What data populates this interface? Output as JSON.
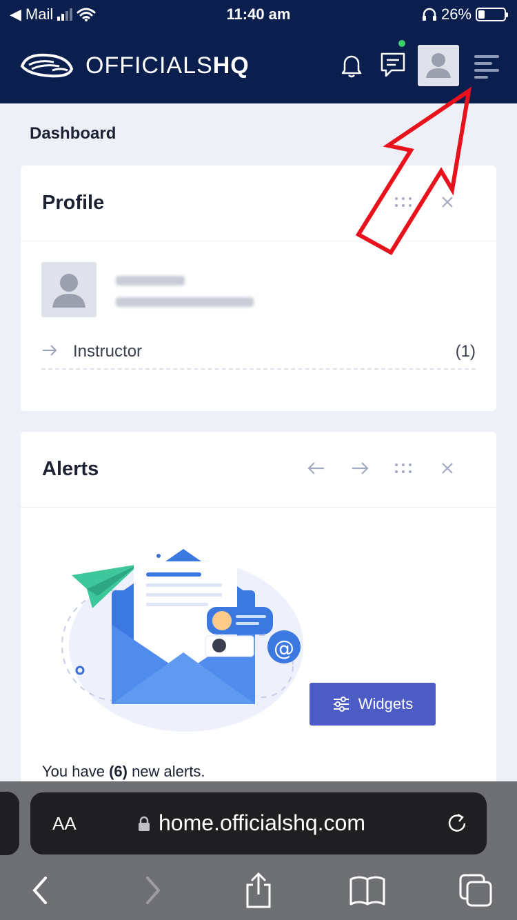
{
  "status_bar": {
    "back_app": "Mail",
    "time": "11:40 am",
    "battery_percent": "26%",
    "battery_level": 0.26
  },
  "header": {
    "brand_prefix": "OFFICIALS",
    "brand_suffix": "HQ",
    "bg_color": "#0b1f4f"
  },
  "breadcrumb": "Dashboard",
  "profile_card": {
    "title": "Profile",
    "role_label": "Instructor",
    "role_count": "(1)"
  },
  "alerts_card": {
    "title": "Alerts",
    "widgets_label": "Widgets",
    "text_before": "You have ",
    "count": "(6)",
    "text_after": " new alerts."
  },
  "browser": {
    "aa_label": "AA",
    "url": "home.officialshq.com"
  },
  "colors": {
    "accent": "#4d5cc4",
    "annotation_arrow": "#e8111c",
    "notification_dot": "#3ccf6e"
  }
}
